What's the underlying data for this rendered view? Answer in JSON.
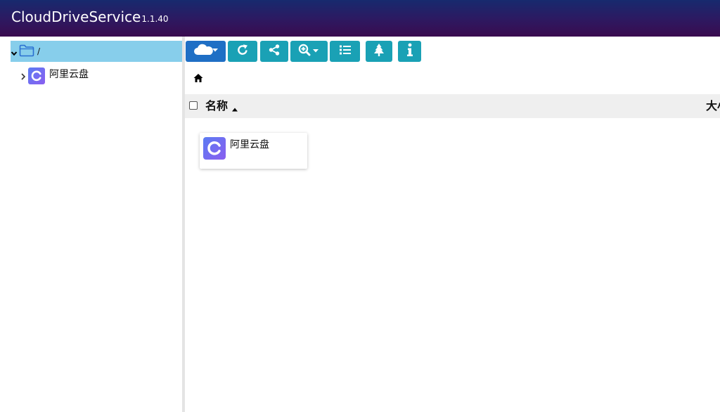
{
  "app": {
    "name": "CloudDriveService",
    "version": "1.1.40"
  },
  "colors": {
    "header_start": "#172a6e",
    "header_end": "#3a0b4f",
    "selected_row": "#87ceeb",
    "button": "#1aa1b5",
    "button_primary": "#1f6fc5"
  },
  "sidebar": {
    "root": {
      "label": "/",
      "icon": "folder-icon",
      "expanded": true
    },
    "children": [
      {
        "label": "阿里云盘",
        "icon": "aliyun-drive-icon"
      }
    ]
  },
  "toolbar": {
    "buttons": [
      {
        "name": "cloud-menu",
        "icon": "cloud-icon"
      },
      {
        "name": "refresh",
        "icon": "refresh-icon"
      },
      {
        "name": "share",
        "icon": "share-icon"
      },
      {
        "name": "zoom-menu",
        "icon": "zoom-in-icon"
      },
      {
        "name": "list-view",
        "icon": "list-icon"
      },
      {
        "name": "tree-view",
        "icon": "tree-icon"
      },
      {
        "name": "info",
        "icon": "info-icon"
      }
    ]
  },
  "breadcrumb": {
    "icon": "home-icon"
  },
  "table": {
    "columns": [
      "名称",
      "大小"
    ],
    "sort": "ascending"
  },
  "files": [
    {
      "name": "阿里云盘",
      "icon": "aliyun-drive-icon"
    }
  ]
}
